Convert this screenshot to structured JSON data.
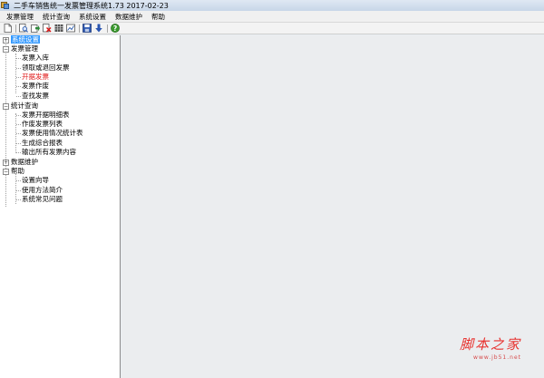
{
  "window": {
    "title": "二手车销售统一发票管理系统1.73 2017-02-23"
  },
  "menu": [
    "发票管理",
    "统计查询",
    "系统设置",
    "数据维护",
    "帮助"
  ],
  "toolbar_icons": [
    "new-icon",
    "find-icon",
    "open-icon",
    "delete-icon",
    "grid-icon",
    "chart-icon",
    "save-icon",
    "download-icon",
    "help-icon"
  ],
  "tree": {
    "root_selected": "系统设置",
    "groups": [
      {
        "label": "发票管理",
        "items": [
          "发票入库",
          "领取或退回发票",
          "开据发票",
          "发票作废",
          "查找发票"
        ]
      },
      {
        "label": "统计查询",
        "items": [
          "发票开据明细表",
          "作废发票列表",
          "发票使用情况统计表",
          "生成综合报表",
          "输出所有发票内容"
        ]
      },
      {
        "label": "数据维护",
        "items": []
      },
      {
        "label": "帮助",
        "items": [
          "设置向导",
          "使用方法简介",
          "系统常见问题"
        ]
      }
    ]
  },
  "watermark": {
    "main": "脚本之家",
    "sub": "www.jb51.net"
  }
}
